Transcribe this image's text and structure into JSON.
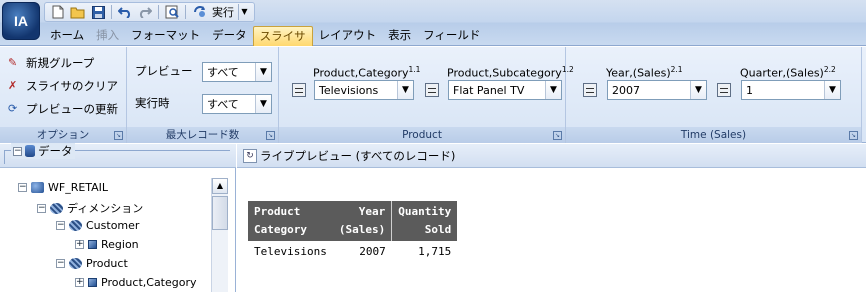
{
  "app": {
    "logo": "IA"
  },
  "qat": {
    "icons": [
      "new-doc-icon",
      "open-folder-icon",
      "save-icon",
      "undo-icon",
      "redo-icon",
      "preview-icon",
      "run-icon"
    ],
    "run_label": "実行"
  },
  "tabs": [
    {
      "label": "ホーム",
      "state": "normal"
    },
    {
      "label": "挿入",
      "state": "disabled"
    },
    {
      "label": "フォーマット",
      "state": "normal"
    },
    {
      "label": "データ",
      "state": "normal"
    },
    {
      "label": "スライサ",
      "state": "active"
    },
    {
      "label": "レイアウト",
      "state": "normal"
    },
    {
      "label": "表示",
      "state": "normal"
    },
    {
      "label": "フィールド",
      "state": "normal"
    }
  ],
  "ribbon": {
    "options": {
      "caption": "オプション",
      "items": [
        {
          "label": "新規グループ",
          "icon": "new-group-icon"
        },
        {
          "label": "スライサのクリア",
          "icon": "clear-slicer-icon"
        },
        {
          "label": "プレビューの更新",
          "icon": "refresh-preview-icon"
        }
      ]
    },
    "max_records": {
      "caption": "最大レコード数",
      "preview_label": "プレビュー",
      "preview_value": "すべて",
      "run_label": "実行時",
      "run_value": "すべて"
    },
    "product": {
      "caption": "Product",
      "filters": [
        {
          "label": "Product,Category",
          "sup": "1.1",
          "value": "Televisions"
        },
        {
          "label": "Product,Subcategory",
          "sup": "1.2",
          "value": "Flat Panel TV"
        }
      ]
    },
    "time": {
      "caption": "Time (Sales)",
      "filters": [
        {
          "label": "Year,(Sales)",
          "sup": "2.1",
          "value": "2007"
        },
        {
          "label": "Quarter,(Sales)",
          "sup": "2.2",
          "value": "1"
        }
      ]
    }
  },
  "data_panel": {
    "title": "データ",
    "tree": [
      {
        "label": "WF_RETAIL",
        "toggle": "−",
        "icon": "database-icon"
      },
      {
        "label": "ディメンション",
        "toggle": "−",
        "icon": "dimension-icon"
      },
      {
        "label": "Customer",
        "toggle": "−",
        "icon": "dimension-icon"
      },
      {
        "label": "Region",
        "toggle": "+",
        "icon": "field-icon"
      },
      {
        "label": "Product",
        "toggle": "−",
        "icon": "dimension-icon"
      },
      {
        "label": "Product,Category",
        "toggle": "+",
        "icon": "field-icon"
      }
    ]
  },
  "preview": {
    "title": "ライブプレビュー (すべてのレコード)",
    "headers": [
      {
        "line1": "Product",
        "line2": "Category"
      },
      {
        "line1": "Year",
        "line2": "(Sales)"
      },
      {
        "line1": "Quantity",
        "line2": "Sold"
      }
    ],
    "rows": [
      [
        "Televisions",
        "2007",
        "1,715"
      ]
    ]
  }
}
